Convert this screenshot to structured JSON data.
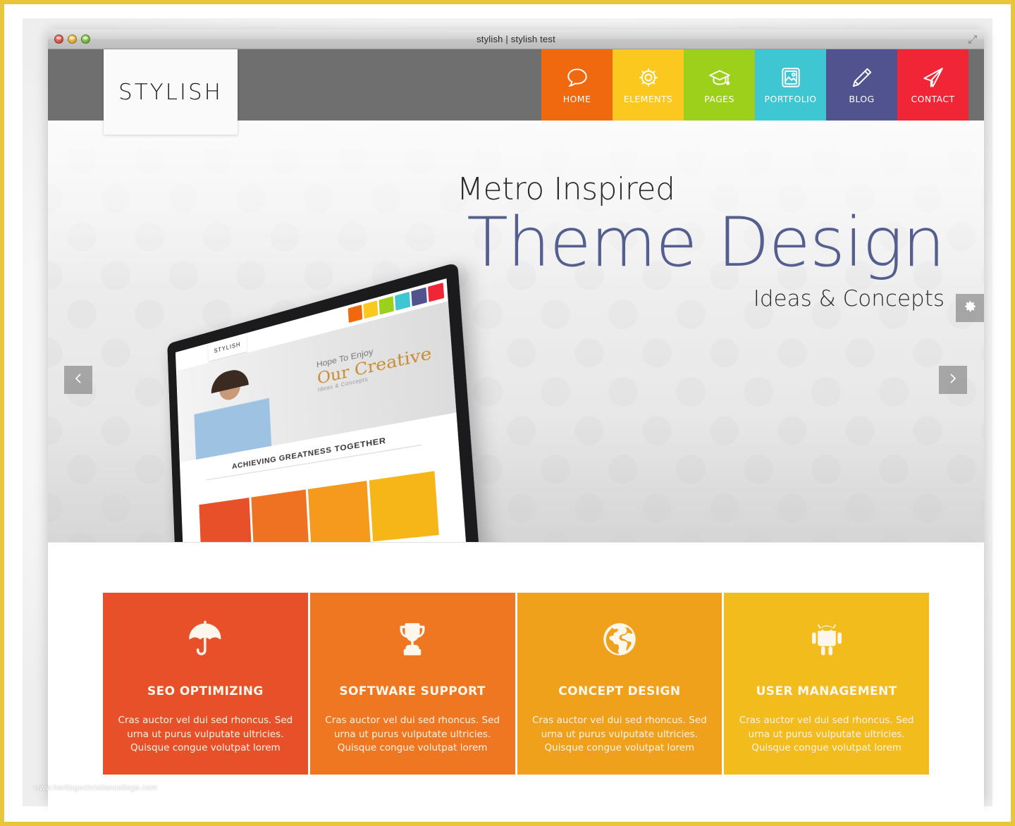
{
  "window": {
    "title": "stylish | stylish test",
    "traffic_lights": [
      {
        "name": "close",
        "color": "#d04a3e"
      },
      {
        "name": "minimize",
        "color": "#d9a323"
      },
      {
        "name": "zoom",
        "color": "#68ad34"
      }
    ],
    "resize_icon": "resize-icon"
  },
  "site": {
    "logo": "STYLISH",
    "nav": [
      {
        "label": "HOME",
        "icon": "speech-bubble-icon",
        "color": "#f1690f"
      },
      {
        "label": "ELEMENTS",
        "icon": "gear-icon",
        "color": "#fac81e"
      },
      {
        "label": "PAGES",
        "icon": "graduation-cap-icon",
        "color": "#9cd01a"
      },
      {
        "label": "PORTFOLIO",
        "icon": "image-frame-icon",
        "color": "#3ec6d2"
      },
      {
        "label": "BLOG",
        "icon": "pencil-icon",
        "color": "#51538f"
      },
      {
        "label": "CONTACT",
        "icon": "paper-plane-icon",
        "color": "#f02636"
      }
    ],
    "header_bg": "#6f6f6f"
  },
  "hero": {
    "line1": "Metro Inspired",
    "line2": "Theme Design",
    "line3": "Ideas & Concepts",
    "accent_color": "#555f8f",
    "prev_label": "‹",
    "next_label": "›",
    "prev_icon": "chevron-left-icon",
    "next_icon": "chevron-right-icon",
    "settings_icon": "gear-icon",
    "laptop_screen": {
      "logo": "STYLISH",
      "caption_line1": "Hope To Enjoy",
      "caption_line2": "Our Creative",
      "caption_line3": "Ideas & Concepts",
      "section_title": "ACHIEVING GREATNESS TOGETHER",
      "nav_colors": [
        "#f1690f",
        "#fac81e",
        "#9cd01a",
        "#3ec6d2",
        "#51538f",
        "#f02636"
      ],
      "tile_colors": [
        "#e8502a",
        "#ef7222",
        "#f59a1c",
        "#f7b618"
      ]
    }
  },
  "features": [
    {
      "title": "SEO OPTIMIZING",
      "icon": "umbrella-icon",
      "color": "#e8502a",
      "desc": "Cras auctor vel dui sed rhoncus. Sed urna ut purus vulputate ultricies. Quisque congue volutpat lorem"
    },
    {
      "title": "SOFTWARE SUPPORT",
      "icon": "trophy-icon",
      "color": "#ef7722",
      "desc": "Cras auctor vel dui sed rhoncus. Sed urna ut purus vulputate ultricies. Quisque congue volutpat lorem"
    },
    {
      "title": "CONCEPT DESIGN",
      "icon": "globe-icon",
      "color": "#f0a11c",
      "desc": "Cras auctor vel dui sed rhoncus. Sed urna ut purus vulputate ultricies. Quisque congue volutpat lorem"
    },
    {
      "title": "USER MANAGEMENT",
      "icon": "android-robot-icon",
      "color": "#f2bc1c",
      "desc": "Cras auctor vel dui sed rhoncus. Sed urna ut purus vulputate ultricies. Quisque congue volutpat lorem"
    }
  ],
  "watermark": "www.heritagechristiancollege.com"
}
